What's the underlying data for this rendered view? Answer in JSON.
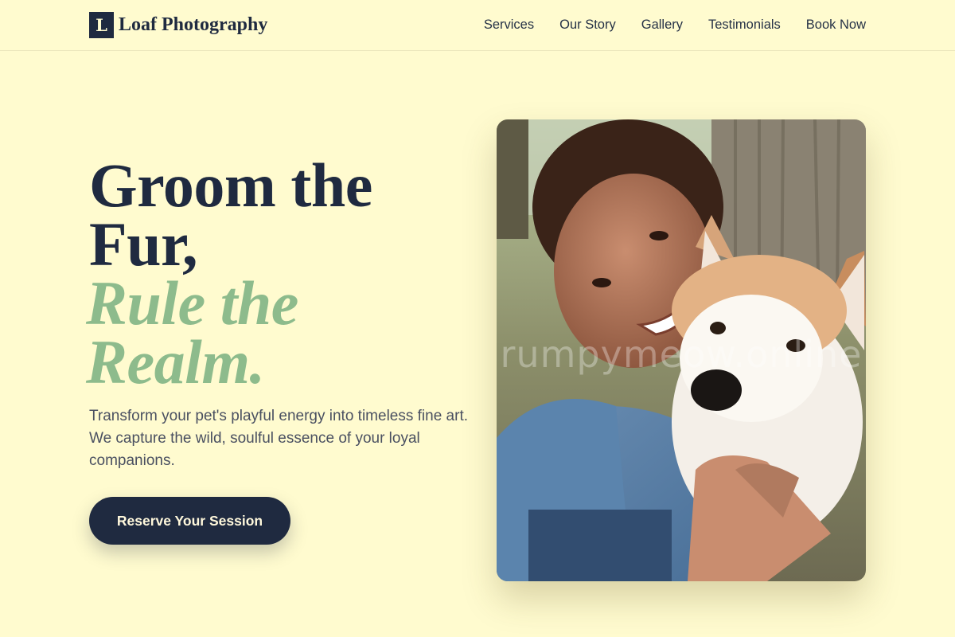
{
  "brand": {
    "mark": "L",
    "name": "Loaf Photography"
  },
  "nav": [
    {
      "label": "Services"
    },
    {
      "label": "Our Story"
    },
    {
      "label": "Gallery"
    },
    {
      "label": "Testimonials"
    },
    {
      "label": "Book Now"
    }
  ],
  "hero": {
    "title_line1": "Groom the",
    "title_line2": "Fur,",
    "title_accent1": "Rule the",
    "title_accent2": "Realm.",
    "description": "Transform your pet's playful energy into timeless fine art. We capture the wild, soulful essence of your loyal companions.",
    "cta": "Reserve Your Session"
  },
  "photo": {
    "watermark": "rumpymeow.online"
  },
  "colors": {
    "background": "#fffbcf",
    "navy": "#1f2a40",
    "accent_green": "#8dbb8c"
  }
}
